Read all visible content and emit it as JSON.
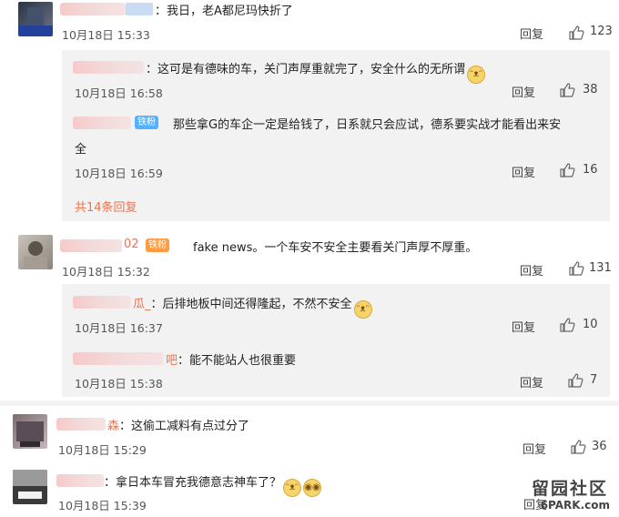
{
  "comments": [
    {
      "text": "：我日，老A都尼玛快折了",
      "date": "10月18日 15:33",
      "reply_label": "回复",
      "likes": "123",
      "replies": [
        {
          "text": "：这可是有德味的车，关门声厚重就完了，安全什么的无所谓",
          "date": "10月18日 16:58",
          "reply_label": "回复",
          "likes": "38"
        },
        {
          "badge": "铁粉",
          "text_line1": "那些拿G的车企一定是给钱了，日系就只会应试，德系要实战才能看出来安",
          "text_line2": "全",
          "date": "10月18日 16:59",
          "reply_label": "回复",
          "likes": "16"
        }
      ],
      "more_replies": "共14条回复"
    },
    {
      "name_suffix": "02",
      "badge": "铁粉",
      "text": "fake news。一个车安不安全主要看关门声厚不厚重。",
      "date": "10月18日 15:32",
      "reply_label": "回复",
      "likes": "131",
      "replies": [
        {
          "name_suffix": "瓜_",
          "text": "：后排地板中间还得隆起，不然不安全",
          "date": "10月18日 16:37",
          "reply_label": "回复",
          "likes": "10"
        },
        {
          "name_suffix": "吧",
          "text": "：能不能站人也很重要",
          "date": "10月18日 15:38",
          "reply_label": "回复",
          "likes": "7"
        }
      ]
    },
    {
      "name_suffix": "森",
      "text": "：这偷工减料有点过分了",
      "date": "10月18日 15:29",
      "reply_label": "回复",
      "likes": "36"
    },
    {
      "text": "：拿日本车冒充我德意志神车了？",
      "date": "10月18日 15:39",
      "reply_label": "回复"
    }
  ],
  "watermark": {
    "line1": "留园社区",
    "line2": "6PARK.com"
  },
  "icons": {
    "like": "thumbs-up-icon",
    "emoji": "smile-emoji-icon"
  }
}
